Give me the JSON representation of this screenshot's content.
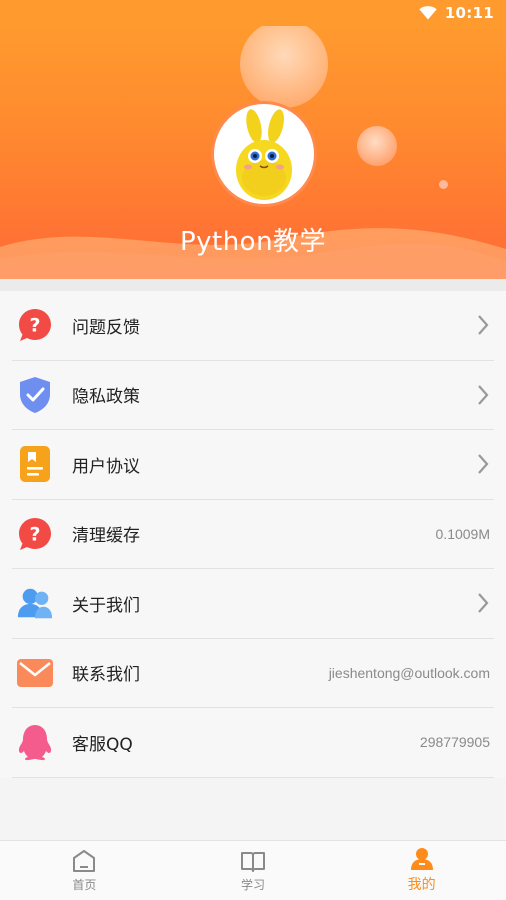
{
  "status_bar": {
    "time": "10:11",
    "icons": [
      "wifi-icon"
    ]
  },
  "profile": {
    "username": "Python教学",
    "avatar_icon": "yellow-bunny-avatar"
  },
  "colors": {
    "header_start": "#ff9a2e",
    "header_end": "#ff6a36",
    "accent": "#ff8c1a"
  },
  "menu": {
    "items": [
      {
        "label": "问题反馈",
        "icon": "question-bubble-icon",
        "value": "",
        "chevron": true
      },
      {
        "label": "隐私政策",
        "icon": "shield-check-icon",
        "value": "",
        "chevron": true
      },
      {
        "label": "用户协议",
        "icon": "agreement-document-icon",
        "value": "",
        "chevron": true
      },
      {
        "label": "清理缓存",
        "icon": "question-bubble-icon",
        "value": "0.1009M",
        "chevron": false
      },
      {
        "label": "关于我们",
        "icon": "users-icon",
        "value": "",
        "chevron": true
      },
      {
        "label": "联系我们",
        "icon": "envelope-icon",
        "value": "jieshentong@outlook.com",
        "chevron": false
      },
      {
        "label": "客服QQ",
        "icon": "qq-penguin-icon",
        "value": "298779905",
        "chevron": false
      }
    ]
  },
  "tabbar": {
    "tabs": [
      {
        "label": "首页",
        "icon": "home-icon",
        "active": false
      },
      {
        "label": "学习",
        "icon": "book-icon",
        "active": false
      },
      {
        "label": "我的",
        "icon": "person-icon",
        "active": true
      }
    ]
  }
}
